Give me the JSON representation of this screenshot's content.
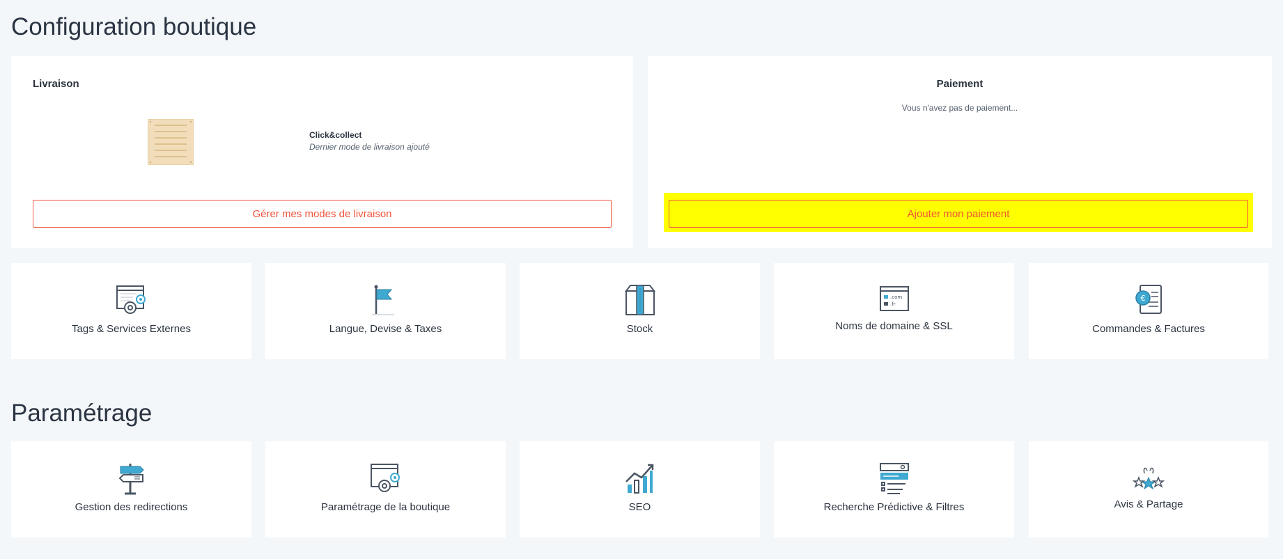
{
  "config": {
    "title": "Configuration boutique",
    "delivery": {
      "title": "Livraison",
      "method_name": "Click&collect",
      "method_sub": "Dernier mode de livraison ajouté",
      "button": "Gérer mes modes de livraison"
    },
    "payment": {
      "title": "Paiement",
      "empty": "Vous n'avez pas de paiement...",
      "button": "Ajouter mon paiement"
    },
    "tiles": [
      {
        "label": "Tags & Services Externes",
        "icon": "tags-gear-icon"
      },
      {
        "label": "Langue, Devise & Taxes",
        "icon": "flag-icon"
      },
      {
        "label": "Stock",
        "icon": "box-icon"
      },
      {
        "label": "Noms de domaine & SSL",
        "icon": "domain-browser-icon"
      },
      {
        "label": "Commandes & Factures",
        "icon": "invoice-euro-icon"
      }
    ]
  },
  "settings": {
    "title": "Paramétrage",
    "tiles": [
      {
        "label": "Gestion des redirections",
        "icon": "signpost-icon"
      },
      {
        "label": "Paramétrage de la boutique",
        "icon": "shop-gear-icon"
      },
      {
        "label": "SEO",
        "icon": "growth-chart-icon"
      },
      {
        "label": "Recherche Prédictive & Filtres",
        "icon": "search-filter-icon"
      },
      {
        "label": "Avis & Partage",
        "icon": "stars-hands-icon"
      }
    ]
  },
  "colors": {
    "accent": "#f0533b",
    "highlight": "#ffff00",
    "icon_blue": "#3fa9d1",
    "icon_gray": "#4a5563"
  }
}
